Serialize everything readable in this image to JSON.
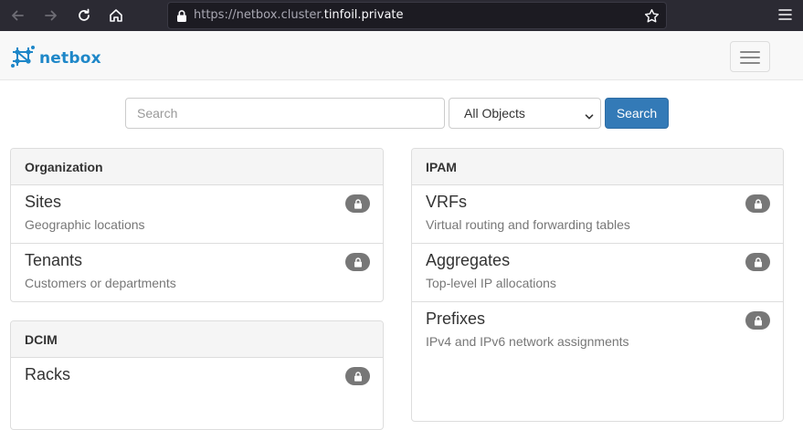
{
  "browser": {
    "url_prefix": "https://netbox.cluster.",
    "url_host": "tinfoil.private",
    "icons": [
      "back-icon",
      "forward-icon",
      "reload-icon",
      "home-icon",
      "lock-icon",
      "bookmark-star-icon",
      "hamburger-menu-icon"
    ]
  },
  "navbar": {
    "brand": "netbox",
    "brand_color": "#1e87c8"
  },
  "search": {
    "placeholder": "Search",
    "value": "",
    "scope_selected": "All Objects",
    "button_label": "Search",
    "button_color": "#337ab7"
  },
  "panels": {
    "organization": {
      "heading": "Organization",
      "items": [
        {
          "title": "Sites",
          "description": "Geographic locations",
          "locked": true
        },
        {
          "title": "Tenants",
          "description": "Customers or departments",
          "locked": true
        }
      ]
    },
    "dcim": {
      "heading": "DCIM",
      "items": [
        {
          "title": "Racks",
          "description": "",
          "locked": true
        }
      ]
    },
    "ipam": {
      "heading": "IPAM",
      "items": [
        {
          "title": "VRFs",
          "description": "Virtual routing and forwarding tables",
          "locked": true
        },
        {
          "title": "Aggregates",
          "description": "Top-level IP allocations",
          "locked": true
        },
        {
          "title": "Prefixes",
          "description": "IPv4 and IPv6 network assignments",
          "locked": true
        }
      ]
    }
  }
}
